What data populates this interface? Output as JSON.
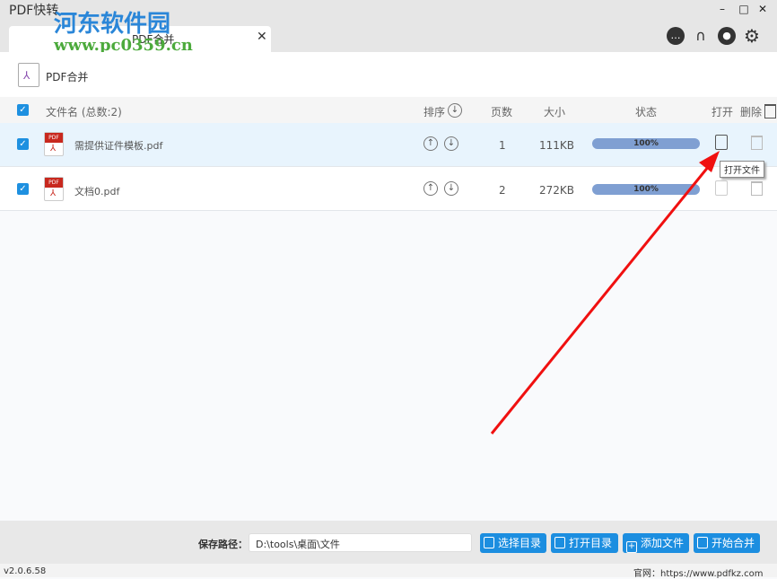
{
  "app": {
    "title": "PDF快转",
    "tab_label": "PDF合并",
    "toolbar_label": "PDF合并"
  },
  "watermark": {
    "name": "河东软件园",
    "url": "www.pc0359.cn"
  },
  "header": {
    "filename": "文件名 (总数:2)",
    "sort": "排序",
    "pages": "页数",
    "size": "大小",
    "status": "状态",
    "open": "打开",
    "delete": "删除"
  },
  "files": [
    {
      "name": "需提供证件模板.pdf",
      "pages": "1",
      "size": "111KB",
      "progress": "100%"
    },
    {
      "name": "文档0.pdf",
      "pages": "2",
      "size": "272KB",
      "progress": "100%"
    }
  ],
  "tooltip": "打开文件",
  "bottom": {
    "save_path_label": "保存路径：",
    "save_path": "D:\\tools\\桌面\\文件",
    "select_dir": "选择目录",
    "open_dir": "打开目录",
    "add_file": "添加文件",
    "start_merge": "开始合并"
  },
  "status": {
    "version": "v2.0.6.58",
    "website": "官网：https://www.pdfkz.com"
  },
  "colors": {
    "accent": "#1c8ee0",
    "progress": "#7f9fd2",
    "arrow": "#f01010"
  }
}
